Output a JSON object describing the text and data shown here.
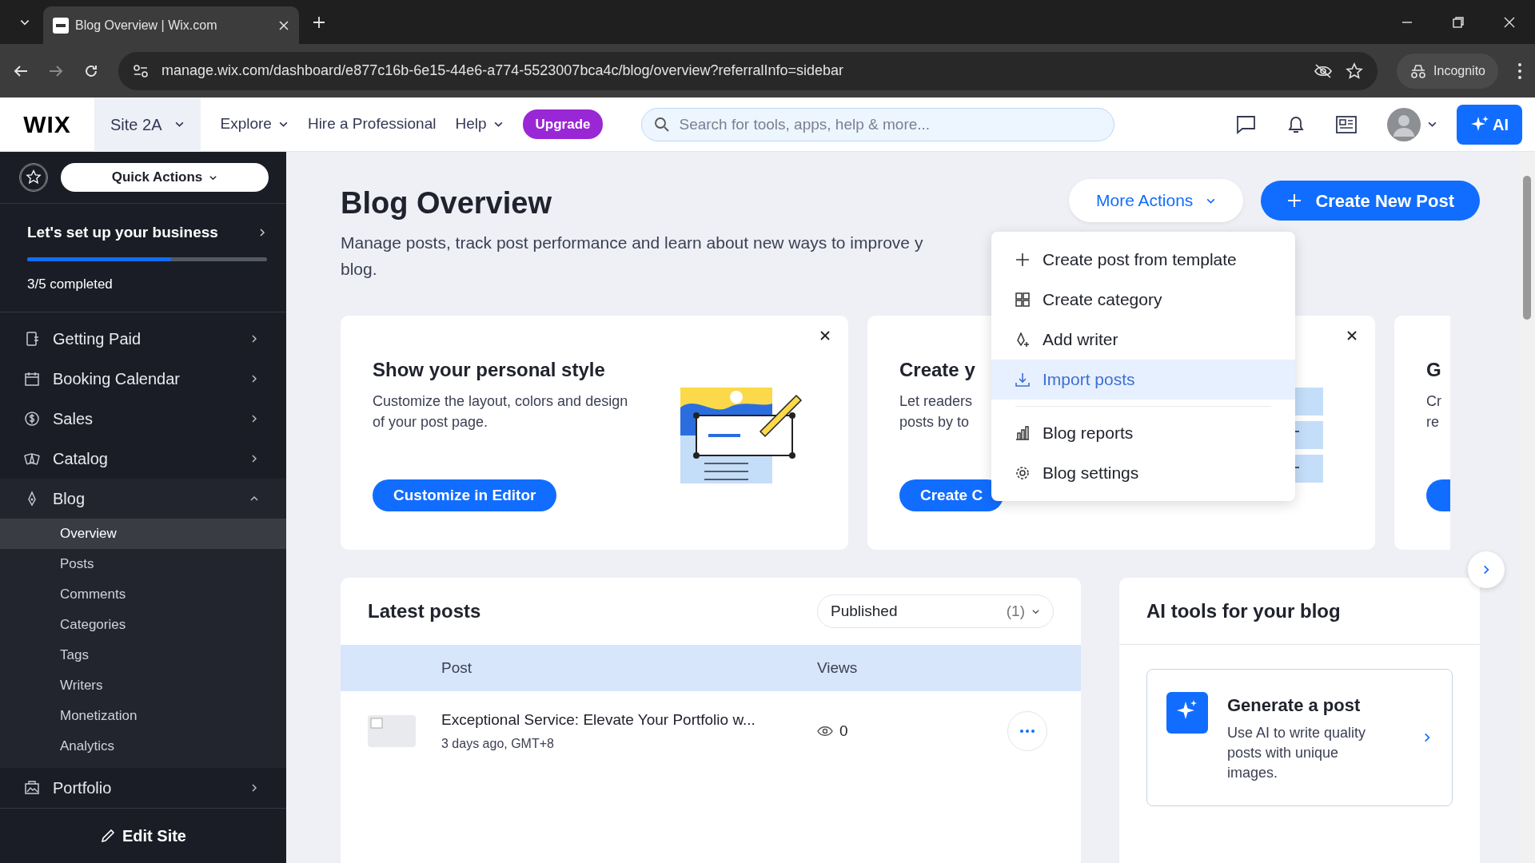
{
  "browser": {
    "tab_title": "Blog Overview | Wix.com",
    "url": "manage.wix.com/dashboard/e877c16b-6e15-44e6-a774-5523007bca4c/blog/overview?referralInfo=sidebar",
    "profile": "Incognito"
  },
  "topbar": {
    "logo": "WIX",
    "site": "Site 2A",
    "menu": [
      {
        "label": "Explore",
        "dropdown": true
      },
      {
        "label": "Hire a Professional",
        "dropdown": false
      },
      {
        "label": "Help",
        "dropdown": true
      }
    ],
    "upgrade": "Upgrade",
    "search": {
      "placeholder": "Search for tools, apps, help & more..."
    },
    "ai": "AI"
  },
  "sidebar": {
    "quick_actions": "Quick Actions",
    "setup": {
      "title": "Let's set up your business",
      "level": 0.6,
      "progress": "3/5 completed"
    },
    "items": [
      {
        "label": "Getting Paid",
        "expanded": false
      },
      {
        "label": "Booking Calendar",
        "expanded": false
      },
      {
        "label": "Sales",
        "expanded": false
      },
      {
        "label": "Catalog",
        "expanded": false
      },
      {
        "label": "Blog",
        "expanded": true,
        "children": [
          {
            "label": "Overview",
            "selected": true
          },
          {
            "label": "Posts",
            "selected": false
          },
          {
            "label": "Comments",
            "selected": false
          },
          {
            "label": "Categories",
            "selected": false
          },
          {
            "label": "Tags",
            "selected": false
          },
          {
            "label": "Writers",
            "selected": false
          },
          {
            "label": "Monetization",
            "selected": false
          },
          {
            "label": "Analytics",
            "selected": false
          }
        ]
      },
      {
        "label": "Portfolio",
        "expanded": false
      }
    ],
    "edit_site": "Edit Site"
  },
  "page": {
    "title": "Blog Overview",
    "subtitle_lines": [
      "Manage posts, track post performance and learn about new ways to improve y",
      "blog."
    ],
    "more_actions": {
      "label": "More Actions",
      "expanded": true,
      "groups": [
        [
          {
            "label": "Create post from template",
            "highlighted": false
          },
          {
            "label": "Create category",
            "highlighted": false
          },
          {
            "label": "Add writer",
            "highlighted": false
          },
          {
            "label": "Import posts",
            "highlighted": true
          }
        ],
        [
          {
            "label": "Blog reports",
            "highlighted": false
          },
          {
            "label": "Blog settings",
            "highlighted": false
          }
        ]
      ]
    },
    "create_button": "Create New Post",
    "cards": [
      {
        "title": "Show your personal style",
        "lines": [
          "Customize the layout, colors and design of your post page."
        ],
        "button": "Customize in Editor",
        "closable": true
      },
      {
        "title": "Create y",
        "lines": [
          "Let readers",
          "posts by to"
        ],
        "button": "Create C",
        "closable": true
      },
      {
        "title": "G",
        "lines": [
          "Cr",
          "re"
        ],
        "closable": false
      }
    ],
    "latest_posts": {
      "title": "Latest posts",
      "filter": {
        "label": "Published",
        "count": "(1)"
      },
      "columns": [
        "Post",
        "Views"
      ],
      "rows": [
        {
          "title": "Exceptional Service: Elevate Your Portfolio w...",
          "meta": "3 days ago, GMT+8",
          "views": "0"
        }
      ]
    },
    "ai_tools": {
      "title": "AI tools for your blog",
      "tools": [
        {
          "title": "Generate a post",
          "description": "Use AI to write quality posts with unique images."
        }
      ]
    }
  }
}
